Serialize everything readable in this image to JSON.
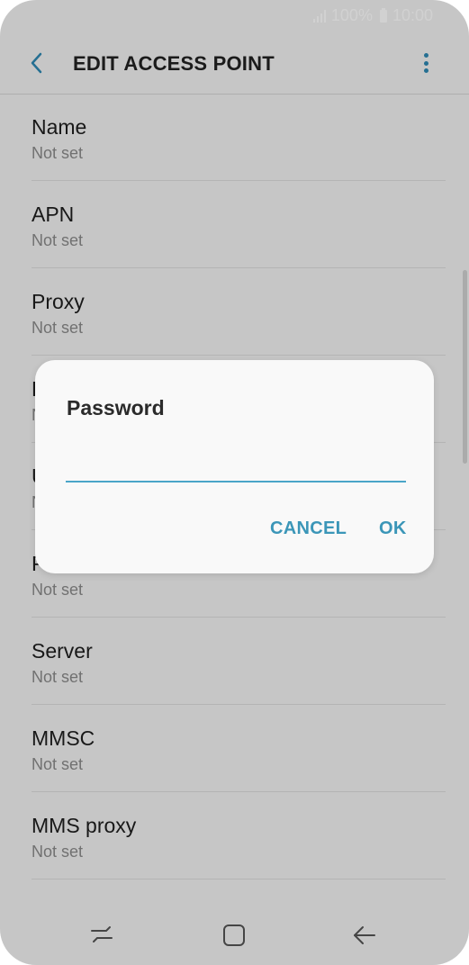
{
  "status_bar": {
    "battery": "100%",
    "time": "10:00",
    "signal_icon": "signal-icon",
    "battery_icon": "battery-icon"
  },
  "header": {
    "title": "EDIT ACCESS POINT",
    "back_icon": "chevron-left-icon",
    "more_icon": "more-vertical-icon",
    "accent_color": "#2e88b2"
  },
  "list": {
    "items": [
      {
        "title": "Name",
        "value": "Not set"
      },
      {
        "title": "APN",
        "value": "Not set"
      },
      {
        "title": "Proxy",
        "value": "Not set"
      },
      {
        "title": "P",
        "value": "N"
      },
      {
        "title": "U",
        "value": "N"
      },
      {
        "title": "P",
        "value": "Not set"
      },
      {
        "title": "Server",
        "value": "Not set"
      },
      {
        "title": "MMSC",
        "value": "Not set"
      },
      {
        "title": "MMS proxy",
        "value": "Not set"
      }
    ]
  },
  "dialog": {
    "title": "Password",
    "input_value": "",
    "cancel_label": "CANCEL",
    "ok_label": "OK",
    "accent_color": "#3b96b8"
  },
  "nav": {
    "recent_icon": "recent-apps-icon",
    "home_icon": "home-icon",
    "back_icon": "back-arrow-icon"
  }
}
